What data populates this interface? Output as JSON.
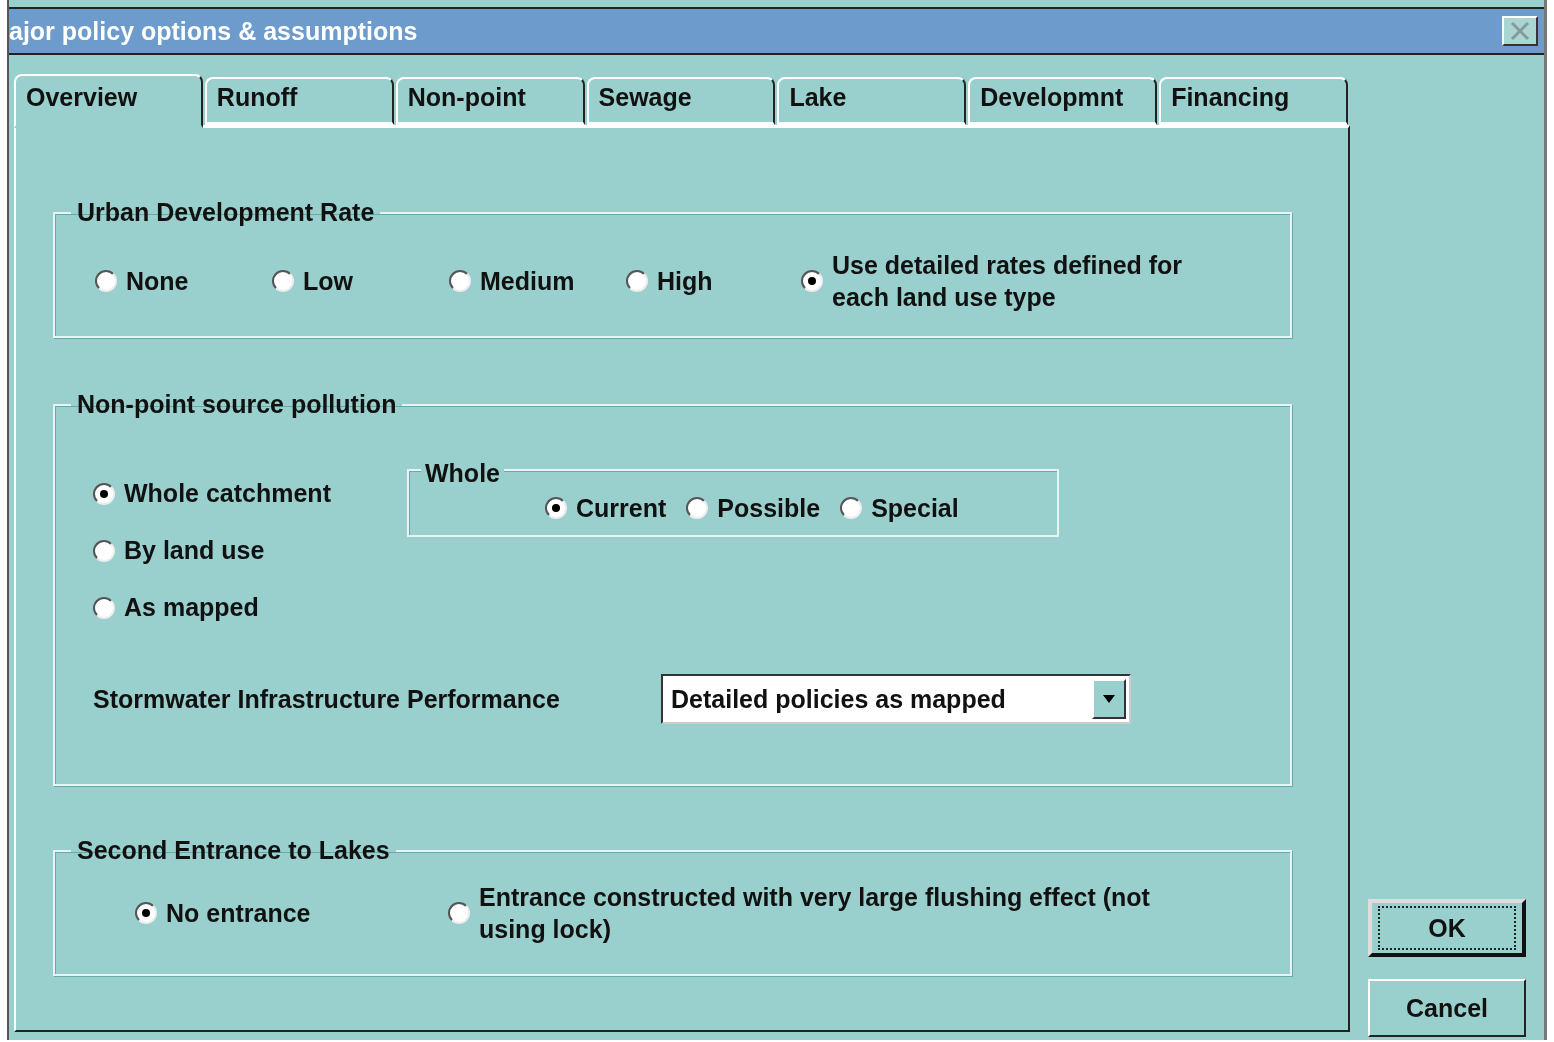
{
  "window": {
    "title": "ajor policy options & assumptions"
  },
  "tabs": [
    {
      "label": "Overview",
      "selected": true
    },
    {
      "label": "Runoff",
      "selected": false
    },
    {
      "label": "Non-point",
      "selected": false
    },
    {
      "label": "Sewage",
      "selected": false
    },
    {
      "label": "Lake",
      "selected": false
    },
    {
      "label": "Developmnt",
      "selected": false
    },
    {
      "label": "Financing",
      "selected": false
    }
  ],
  "urban_development_rate": {
    "legend": "Urban Development Rate",
    "options": [
      {
        "label": "None",
        "selected": false
      },
      {
        "label": "Low",
        "selected": false
      },
      {
        "label": "Medium",
        "selected": false
      },
      {
        "label": "High",
        "selected": false
      },
      {
        "label": "Use detailed rates defined for each land use type",
        "selected": true
      }
    ]
  },
  "non_point_source_pollution": {
    "legend": "Non-point source pollution",
    "options": [
      {
        "label": "Whole catchment",
        "selected": true
      },
      {
        "label": "By land use",
        "selected": false
      },
      {
        "label": "As mapped",
        "selected": false
      }
    ],
    "whole": {
      "legend": "Whole",
      "options": [
        {
          "label": "Current",
          "selected": true
        },
        {
          "label": "Possible",
          "selected": false
        },
        {
          "label": "Special",
          "selected": false
        }
      ]
    },
    "stormwater": {
      "label": "Stormwater Infrastructure Performance",
      "value": "Detailed policies as mapped"
    }
  },
  "second_entrance": {
    "legend": "Second Entrance to Lakes",
    "options": [
      {
        "label": "No entrance",
        "selected": true
      },
      {
        "label": "Entrance constructed with very large flushing effect (not using lock)",
        "selected": false
      }
    ]
  },
  "buttons": [
    {
      "label": "OK",
      "default": true
    },
    {
      "label": "Cancel",
      "default": false
    }
  ]
}
